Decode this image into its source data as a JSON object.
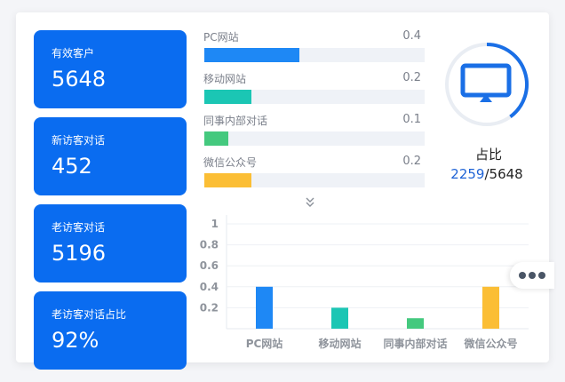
{
  "stats": [
    {
      "label": "有效客户",
      "value": "5648"
    },
    {
      "label": "新访客对话",
      "value": "452"
    },
    {
      "label": "老访客对话",
      "value": "5196"
    },
    {
      "label": "老访客对话占比",
      "value": "92%"
    }
  ],
  "channels": [
    {
      "name": "PC网站",
      "share": 0.4,
      "share_label": "0.4",
      "color": "#1e88f5"
    },
    {
      "name": "移动网站",
      "share": 0.2,
      "share_label": "0.2",
      "color": "#1bc6b4"
    },
    {
      "name": "同事内部对话",
      "share": 0.1,
      "share_label": "0.1",
      "color": "#44c97e"
    },
    {
      "name": "微信公众号",
      "share": 0.2,
      "share_label": "0.2",
      "color": "#fbbe35"
    }
  ],
  "ratio": {
    "title": "占比",
    "part": "2259",
    "separator": "/",
    "total": "5648",
    "fraction": 0.4,
    "icon": "monitor-icon",
    "ring_color": "#1a6fe6",
    "track_color": "#e9edf3"
  },
  "expand_icon": "double-chevron-down-icon",
  "more_icon": "more-dots-icon",
  "chart_data": {
    "type": "bar",
    "categories": [
      "PC网站",
      "移动网站",
      "同事内部对话",
      "微信公众号"
    ],
    "values": [
      0.4,
      0.2,
      0.1,
      0.4
    ],
    "colors": [
      "#1e88f5",
      "#1bc6b4",
      "#44c97e",
      "#fbbe35"
    ],
    "ylim": [
      0,
      1
    ],
    "yticks": [
      0.2,
      0.4,
      0.6,
      0.8,
      1
    ],
    "ytick_labels": [
      "0.2",
      "0.4",
      "0.6",
      "0.8",
      "1"
    ],
    "grid": true,
    "title": "",
    "xlabel": "",
    "ylabel": ""
  }
}
